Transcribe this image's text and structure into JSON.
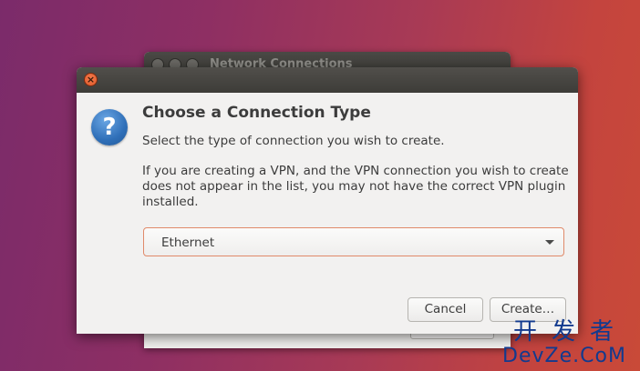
{
  "background_window": {
    "title": "Network Connections"
  },
  "dialog": {
    "heading": "Choose a Connection Type",
    "subtext": "Select the type of connection you wish to create.",
    "description": "If you are creating a VPN, and the VPN connection you wish to create does not appear in the list, you may not have the correct VPN plugin installed.",
    "connection_type": {
      "selected": "Ethernet"
    },
    "buttons": {
      "cancel": "Cancel",
      "create": "Create…"
    },
    "close_glyph": "×",
    "icon_glyph": "?"
  },
  "watermark": {
    "chinese": "开发者",
    "latin": "DevZe.CoM"
  },
  "colors": {
    "accent_border": "#e08a6a",
    "titlebar": "#3d3c38",
    "close_button": "#e05a2a",
    "question_icon": "#2f6fb8",
    "watermark": "#123a8e"
  }
}
